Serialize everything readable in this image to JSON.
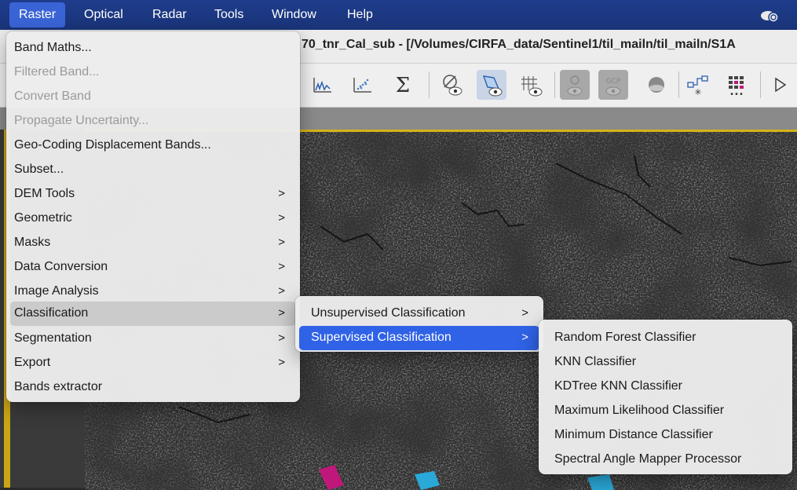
{
  "menubar": {
    "items": [
      "Raster",
      "Optical",
      "Radar",
      "Tools",
      "Window",
      "Help"
    ],
    "active_index": 0
  },
  "window": {
    "title": "70_tnr_Cal_sub - [/Volumes/CIRFA_data/Sentinel1/til_mailn/til_mailn/S1A"
  },
  "raster_menu": {
    "items": [
      {
        "label": "Band Maths...",
        "enabled": true,
        "submenu": false
      },
      {
        "label": "Filtered Band...",
        "enabled": false,
        "submenu": false
      },
      {
        "label": "Convert Band",
        "enabled": false,
        "submenu": false
      },
      {
        "label": "Propagate Uncertainty...",
        "enabled": false,
        "submenu": false
      },
      {
        "label": "Geo-Coding Displacement Bands...",
        "enabled": true,
        "submenu": false
      },
      {
        "label": "Subset...",
        "enabled": true,
        "submenu": false
      },
      {
        "label": "DEM Tools",
        "enabled": true,
        "submenu": true
      },
      {
        "label": "Geometric",
        "enabled": true,
        "submenu": true
      },
      {
        "label": "Masks",
        "enabled": true,
        "submenu": true
      },
      {
        "label": "Data Conversion",
        "enabled": true,
        "submenu": true
      },
      {
        "label": "Image Analysis",
        "enabled": true,
        "submenu": true
      },
      {
        "label": "Classification",
        "enabled": true,
        "submenu": true
      },
      {
        "label": "Segmentation",
        "enabled": true,
        "submenu": true
      },
      {
        "label": "Export",
        "enabled": true,
        "submenu": true
      },
      {
        "label": "Bands extractor",
        "enabled": true,
        "submenu": false
      }
    ],
    "highlighted": "Classification"
  },
  "classification_menu": {
    "items": [
      {
        "label": "Unsupervised Classification",
        "submenu": true
      },
      {
        "label": "Supervised Classification",
        "submenu": true
      }
    ],
    "selected": "Supervised Classification"
  },
  "supervised_menu": {
    "items": [
      "Random Forest Classifier",
      "KNN Classifier",
      "KDTree KNN Classifier",
      "Maximum Likelihood Classifier",
      "Minimum Distance Classifier",
      "Spectral Angle Mapper Processor"
    ]
  },
  "toolbar": {
    "icons": [
      "spectrum-icon",
      "scatter-plot-icon",
      "sigma-icon",
      "no-visibility-icon",
      "pin-visibility-icon",
      "grid-visibility-icon",
      "eye-disabled-icon",
      "gcp-icon",
      "sphere-icon",
      "graph-icon",
      "matrix-icon"
    ],
    "sigma_glyph": "Σ",
    "gcp_text": "GCP"
  },
  "colors": {
    "menubar": "#1e3c8c",
    "menu_selected": "#2f62e6",
    "image_border": "#d7b316",
    "vector_magenta": "#c0187a",
    "vector_cyan": "#2aa8d8"
  }
}
